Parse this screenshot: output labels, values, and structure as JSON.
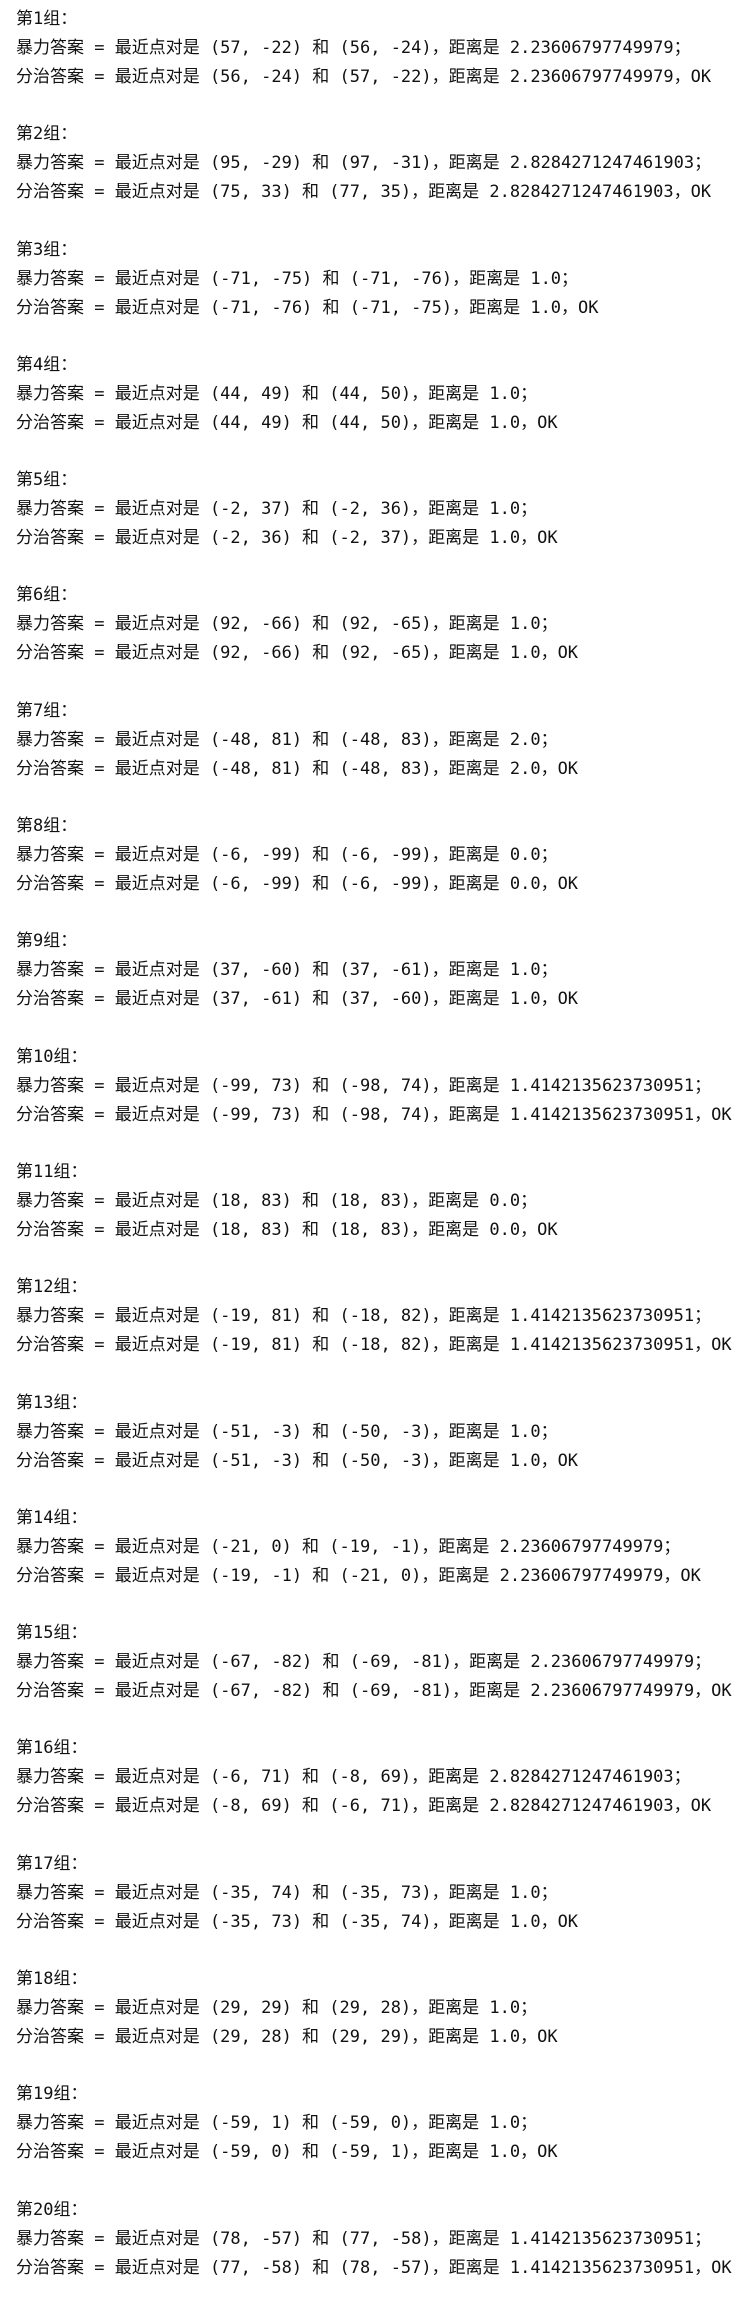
{
  "groups": [
    {
      "header": "第1组：",
      "brute": "暴力答案 = 最近点对是 (57, -22) 和 (56, -24)，距离是 2.23606797749979；",
      "divide": "分治答案 = 最近点对是 (56, -24) 和 (57, -22)，距离是 2.23606797749979，OK"
    },
    {
      "header": "第2组：",
      "brute": "暴力答案 = 最近点对是 (95, -29) 和 (97, -31)，距离是 2.8284271247461903；",
      "divide": "分治答案 = 最近点对是 (75, 33) 和 (77, 35)，距离是 2.8284271247461903，OK"
    },
    {
      "header": "第3组：",
      "brute": "暴力答案 = 最近点对是 (-71, -75) 和 (-71, -76)，距离是 1.0；",
      "divide": "分治答案 = 最近点对是 (-71, -76) 和 (-71, -75)，距离是 1.0，OK"
    },
    {
      "header": "第4组：",
      "brute": "暴力答案 = 最近点对是 (44, 49) 和 (44, 50)，距离是 1.0；",
      "divide": "分治答案 = 最近点对是 (44, 49) 和 (44, 50)，距离是 1.0，OK"
    },
    {
      "header": "第5组：",
      "brute": "暴力答案 = 最近点对是 (-2, 37) 和 (-2, 36)，距离是 1.0；",
      "divide": "分治答案 = 最近点对是 (-2, 36) 和 (-2, 37)，距离是 1.0，OK"
    },
    {
      "header": "第6组：",
      "brute": "暴力答案 = 最近点对是 (92, -66) 和 (92, -65)，距离是 1.0；",
      "divide": "分治答案 = 最近点对是 (92, -66) 和 (92, -65)，距离是 1.0，OK"
    },
    {
      "header": "第7组：",
      "brute": "暴力答案 = 最近点对是 (-48, 81) 和 (-48, 83)，距离是 2.0；",
      "divide": "分治答案 = 最近点对是 (-48, 81) 和 (-48, 83)，距离是 2.0，OK"
    },
    {
      "header": "第8组：",
      "brute": "暴力答案 = 最近点对是 (-6, -99) 和 (-6, -99)，距离是 0.0；",
      "divide": "分治答案 = 最近点对是 (-6, -99) 和 (-6, -99)，距离是 0.0，OK"
    },
    {
      "header": "第9组：",
      "brute": "暴力答案 = 最近点对是 (37, -60) 和 (37, -61)，距离是 1.0；",
      "divide": "分治答案 = 最近点对是 (37, -61) 和 (37, -60)，距离是 1.0，OK"
    },
    {
      "header": "第10组：",
      "brute": "暴力答案 = 最近点对是 (-99, 73) 和 (-98, 74)，距离是 1.4142135623730951；",
      "divide": "分治答案 = 最近点对是 (-99, 73) 和 (-98, 74)，距离是 1.4142135623730951，OK"
    },
    {
      "header": "第11组：",
      "brute": "暴力答案 = 最近点对是 (18, 83) 和 (18, 83)，距离是 0.0；",
      "divide": "分治答案 = 最近点对是 (18, 83) 和 (18, 83)，距离是 0.0，OK"
    },
    {
      "header": "第12组：",
      "brute": "暴力答案 = 最近点对是 (-19, 81) 和 (-18, 82)，距离是 1.4142135623730951；",
      "divide": "分治答案 = 最近点对是 (-19, 81) 和 (-18, 82)，距离是 1.4142135623730951，OK"
    },
    {
      "header": "第13组：",
      "brute": "暴力答案 = 最近点对是 (-51, -3) 和 (-50, -3)，距离是 1.0；",
      "divide": "分治答案 = 最近点对是 (-51, -3) 和 (-50, -3)，距离是 1.0，OK"
    },
    {
      "header": "第14组：",
      "brute": "暴力答案 = 最近点对是 (-21, 0) 和 (-19, -1)，距离是 2.23606797749979；",
      "divide": "分治答案 = 最近点对是 (-19, -1) 和 (-21, 0)，距离是 2.23606797749979，OK"
    },
    {
      "header": "第15组：",
      "brute": "暴力答案 = 最近点对是 (-67, -82) 和 (-69, -81)，距离是 2.23606797749979；",
      "divide": "分治答案 = 最近点对是 (-67, -82) 和 (-69, -81)，距离是 2.23606797749979，OK"
    },
    {
      "header": "第16组：",
      "brute": "暴力答案 = 最近点对是 (-6, 71) 和 (-8, 69)，距离是 2.8284271247461903；",
      "divide": "分治答案 = 最近点对是 (-8, 69) 和 (-6, 71)，距离是 2.8284271247461903，OK"
    },
    {
      "header": "第17组：",
      "brute": "暴力答案 = 最近点对是 (-35, 74) 和 (-35, 73)，距离是 1.0；",
      "divide": "分治答案 = 最近点对是 (-35, 73) 和 (-35, 74)，距离是 1.0，OK"
    },
    {
      "header": "第18组：",
      "brute": "暴力答案 = 最近点对是 (29, 29) 和 (29, 28)，距离是 1.0；",
      "divide": "分治答案 = 最近点对是 (29, 28) 和 (29, 29)，距离是 1.0，OK"
    },
    {
      "header": "第19组：",
      "brute": "暴力答案 = 最近点对是 (-59, 1) 和 (-59, 0)，距离是 1.0；",
      "divide": "分治答案 = 最近点对是 (-59, 0) 和 (-59, 1)，距离是 1.0，OK"
    },
    {
      "header": "第20组：",
      "brute": "暴力答案 = 最近点对是 (78, -57) 和 (77, -58)，距离是 1.4142135623730951；",
      "divide": "分治答案 = 最近点对是 (77, -58) 和 (78, -57)，距离是 1.4142135623730951，OK"
    }
  ]
}
